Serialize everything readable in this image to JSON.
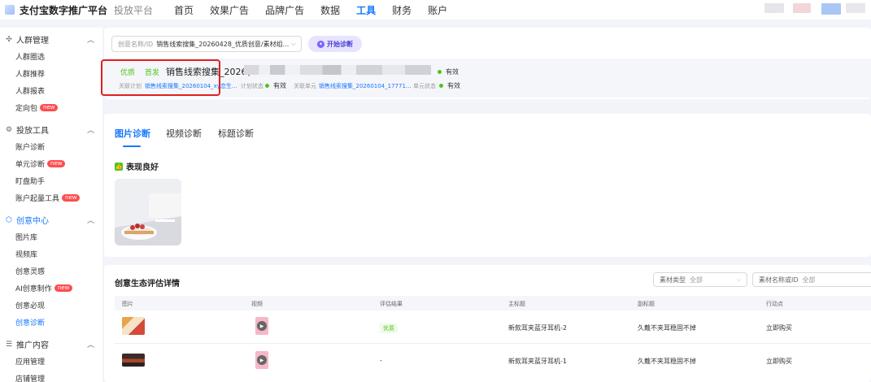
{
  "topbar": {
    "brand": "支付宝数字推广平台",
    "platform": "投放平台",
    "nav": [
      {
        "label": "首页",
        "active": false
      },
      {
        "label": "效果广告",
        "active": false
      },
      {
        "label": "品牌广告",
        "active": false
      },
      {
        "label": "数据",
        "active": false
      },
      {
        "label": "工具",
        "active": true
      },
      {
        "label": "财务",
        "active": false
      },
      {
        "label": "账户",
        "active": false
      }
    ]
  },
  "sidebar": {
    "groups": [
      {
        "title": "人群管理",
        "icon": "crosshair-icon",
        "items": [
          "人群圈选",
          "人群推荐",
          "人群报表",
          "定向包"
        ]
      },
      {
        "title": "投放工具",
        "icon": "gear-icon",
        "items": [
          "账户诊断",
          "单元诊断",
          "盯盘助手",
          "账户起量工具"
        ]
      },
      {
        "title": "创意中心",
        "icon": "shield-icon",
        "items": [
          "图片库",
          "视频库",
          "创意灵感",
          "AI创意制作",
          "创意必现",
          "创意诊断"
        ]
      },
      {
        "title": "推广内容",
        "icon": "list-icon",
        "items": [
          "应用管理",
          "店铺管理"
        ]
      }
    ],
    "new_label": "new"
  },
  "creative_select": {
    "placeholder": "创意名称/ID",
    "value": "销售线索搜集_20260428_优质创意/素材组..."
  },
  "diagnose_button": "开始诊断",
  "creative_info": {
    "tag_quality": "优质",
    "tag_first": "首发",
    "name": "销售线索搜集_2026(",
    "status": "有效",
    "plan_label": "关联计划",
    "plan_value": "销售线索搜集_20260104_xy恋生...",
    "plan_status_label": "计划状态",
    "plan_status": "有效",
    "unit_label": "关联单元",
    "unit_value": "销售线索搜集_20260104_17771...",
    "unit_status_label": "单元状态",
    "unit_status": "有效"
  },
  "tabs": [
    {
      "label": "图片诊断",
      "active": true
    },
    {
      "label": "视频诊断",
      "active": false
    },
    {
      "label": "标题诊断",
      "active": false
    }
  ],
  "performance": "表现良好",
  "table_section": {
    "title": "创意生态评估详情",
    "filter_type_label": "素材类型",
    "filter_type_value": "全部",
    "filter_search_label": "素材名称或ID",
    "filter_search_value": "全部",
    "headers": [
      "图片",
      "视频",
      "评估结果",
      "主标题",
      "副标题",
      "行动点"
    ],
    "rows": [
      {
        "result": "优质",
        "title": "新款耳夹蓝牙耳机-2",
        "subtitle": "久戴不夹耳稳固不掉",
        "action": "立即购买"
      },
      {
        "result": "-",
        "title": "新款耳夹蓝牙耳机-1",
        "subtitle": "久戴不夹耳稳固不掉",
        "action": "立即购买"
      }
    ]
  },
  "colors": {
    "accent": "#1677ff",
    "good": "#52c41a",
    "highlight": "#e02020",
    "new_badge": "#ff4d4f"
  }
}
